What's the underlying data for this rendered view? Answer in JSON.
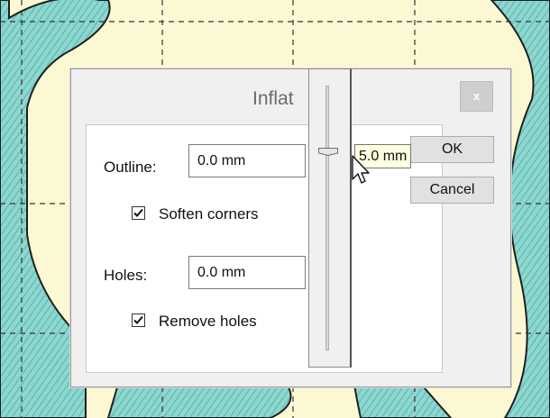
{
  "dialog": {
    "title": "Inflat",
    "close_label": "x",
    "outline": {
      "label": "Outline:",
      "value": "0.0 mm"
    },
    "soften_corners": {
      "label": "Soften corners",
      "checked": true
    },
    "holes": {
      "label": "Holes:",
      "value": "0.0 mm"
    },
    "remove_holes": {
      "label": "Remove holes",
      "checked": true
    },
    "ok_label": "OK",
    "cancel_label": "Cancel"
  },
  "slider": {
    "tooltip": "5.0 mm",
    "level": 0.25
  },
  "icons": {
    "close": "close-icon",
    "check": "check-icon",
    "cursor": "arrow-cursor-icon"
  }
}
